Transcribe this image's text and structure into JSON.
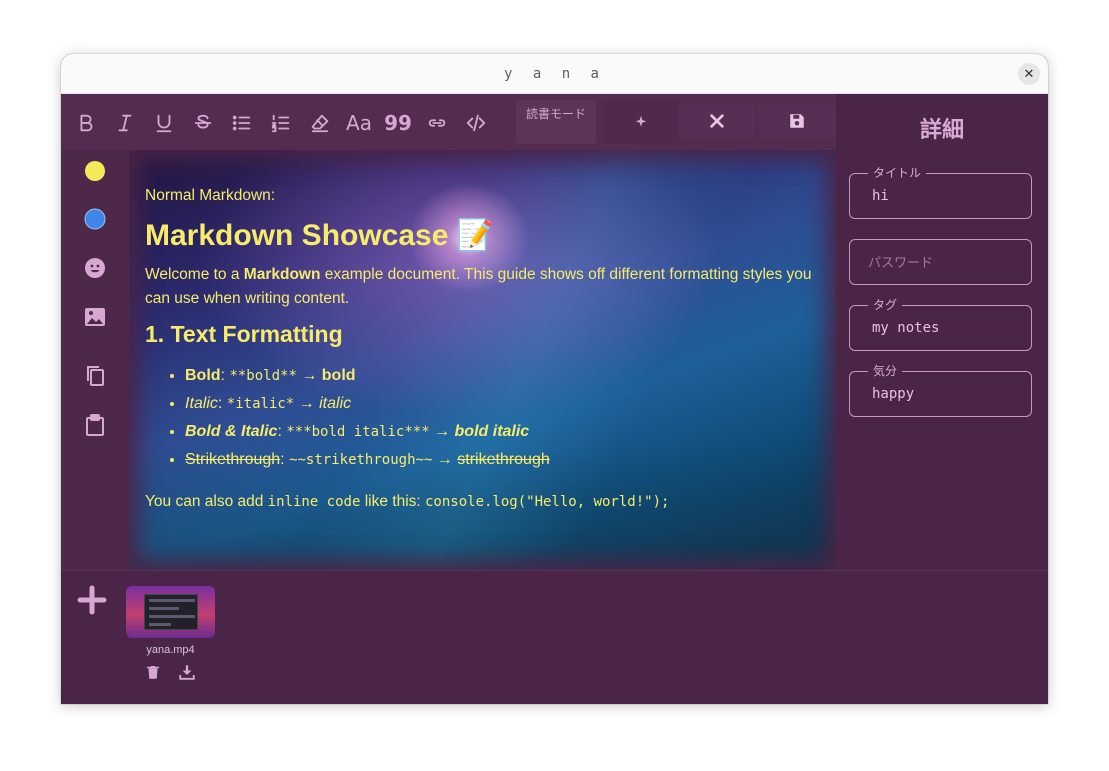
{
  "window": {
    "title": "y a n a",
    "close_label": "✕"
  },
  "toolbar": {
    "bold_icon": "bold-icon",
    "italic_icon": "italic-icon",
    "underline_icon": "underline-icon",
    "strike_icon": "strikethrough-icon",
    "bullet_icon": "bullet-list-icon",
    "number_icon": "numbered-list-icon",
    "clear_icon": "clear-format-icon",
    "heading_label": "Aa",
    "quote_label": "99",
    "link_icon": "link-icon",
    "code_icon": "code-icon",
    "read_mode_label": "読書モード",
    "ai_icon": "sparkle-icon",
    "close_icon": "close-icon",
    "save_icon": "save-icon"
  },
  "sidebar": {
    "items": [
      {
        "icon": "yellow-circle-icon",
        "color": "#f5e95b"
      },
      {
        "icon": "blue-circle-icon",
        "color": "#3f86e8"
      },
      {
        "icon": "emoji-icon"
      },
      {
        "icon": "image-icon"
      },
      {
        "icon": "copy-icon"
      },
      {
        "icon": "clipboard-icon"
      }
    ]
  },
  "editor": {
    "text_color": "#f7ec6a",
    "intro": "Normal Markdown:",
    "h1": "Markdown Showcase",
    "h1_emoji": "📝",
    "welcome_pre": "Welcome to a ",
    "welcome_bold": "Markdown",
    "welcome_post": " example document. This guide shows off different formatting styles you can use when writing content.",
    "h2": "1. Text Formatting",
    "list": [
      {
        "label": "Bold",
        "sep": ": ",
        "code": "**bold**",
        "arrow": " → ",
        "result": "bold"
      },
      {
        "label": "Italic",
        "sep": ": ",
        "code": "*italic*",
        "arrow": " → ",
        "result": "italic"
      },
      {
        "label": "Bold & Italic",
        "sep": ": ",
        "code": "***bold italic***",
        "arrow": " → ",
        "result": "bold italic"
      },
      {
        "label": "Strikethrough",
        "sep": ": ",
        "code": "~~strikethrough~~",
        "arrow": " → ",
        "result": "strikethrough"
      }
    ],
    "inline_pre": "You can also add ",
    "inline_code": "inline code",
    "inline_mid": " like this: ",
    "inline_code2": "console.log(\"Hello, world!\");"
  },
  "details": {
    "title": "詳細",
    "fields": [
      {
        "legend": "タイトル",
        "value": "hi"
      },
      {
        "legend": "",
        "placeholder": "パスワード"
      },
      {
        "legend": "タグ",
        "value": "my notes"
      },
      {
        "legend": "気分",
        "value": "happy"
      }
    ]
  },
  "attachments": {
    "add_icon": "plus-icon",
    "files": [
      {
        "name": "yana.mp4",
        "delete_icon": "trash-icon",
        "download_icon": "download-icon"
      }
    ]
  }
}
